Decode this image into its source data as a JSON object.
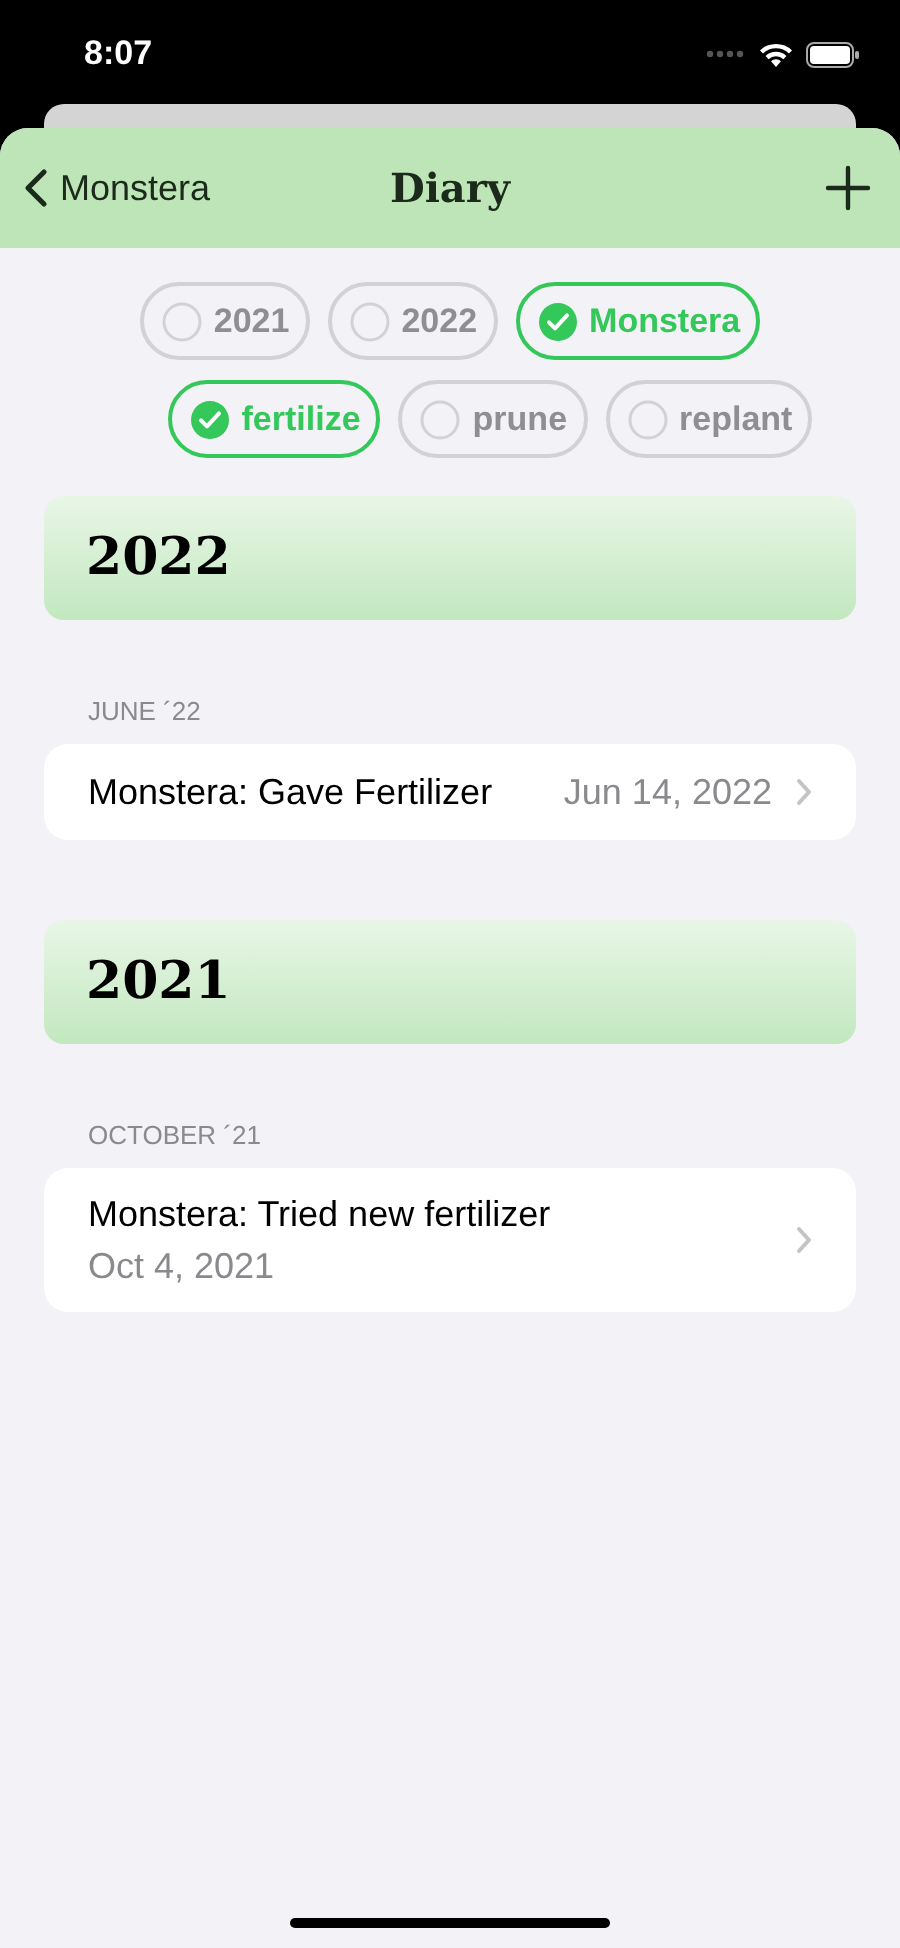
{
  "status_bar": {
    "time": "8:07"
  },
  "nav": {
    "back": "Monstera",
    "title": "Diary"
  },
  "filters": [
    {
      "label": "2021",
      "selected": false
    },
    {
      "label": "2022",
      "selected": false
    },
    {
      "label": "Monstera",
      "selected": true
    },
    {
      "label": "fertilize",
      "selected": true
    },
    {
      "label": "prune",
      "selected": false
    },
    {
      "label": "replant",
      "selected": false
    }
  ],
  "sections": [
    {
      "year": "2022",
      "groups": [
        {
          "month": "JUNE ´22",
          "entries": [
            {
              "kind": "inline",
              "title": "Monstera: Gave Fertilizer",
              "date": "Jun 14, 2022"
            }
          ]
        }
      ]
    },
    {
      "year": "2021",
      "groups": [
        {
          "month": "OCTOBER ´21",
          "entries": [
            {
              "kind": "stacked",
              "title": "Monstera: Tried new fertilizer",
              "date": "Oct 4, 2021"
            }
          ]
        }
      ]
    }
  ]
}
